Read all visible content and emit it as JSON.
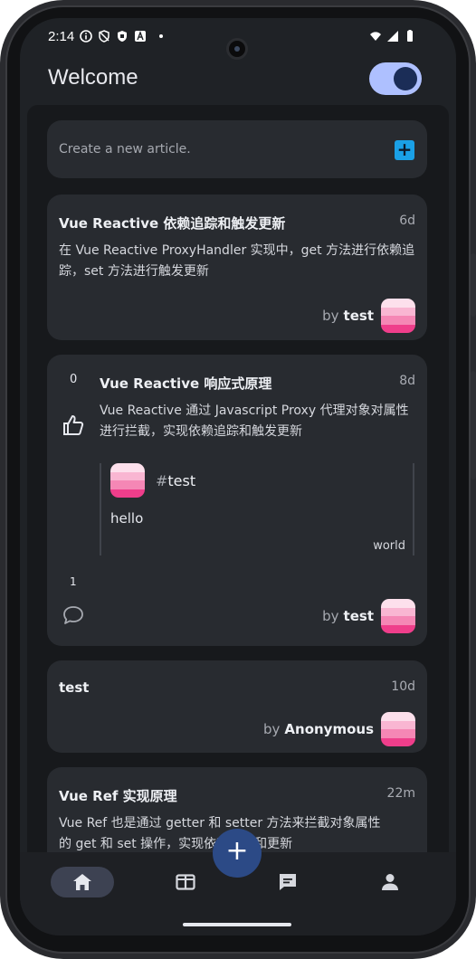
{
  "status_bar": {
    "time": "2:14"
  },
  "app": {
    "title": "Welcome",
    "dark_mode": true
  },
  "composer": {
    "placeholder": "Create a new article."
  },
  "articles": [
    {
      "title": "Vue Reactive 依赖追踪和触发更新",
      "age": "6d",
      "body": "在 Vue Reactive ProxyHandler 实现中，get 方法进行依赖追踪，set 方法进行触发更新",
      "by_label": "by",
      "author": "test"
    },
    {
      "votes": "0",
      "title": "Vue Reactive 响应式原理",
      "age": "8d",
      "body": "Vue Reactive 通过 Javascript Proxy  代理对象对属性进行拦截，实现依赖追踪和触发更新",
      "quote": {
        "hash": "#",
        "tag": "test",
        "text": "hello",
        "link": "world"
      },
      "comments": "1",
      "by_label": "by",
      "author": "test"
    },
    {
      "title": "test",
      "age": "10d",
      "by_label": "by",
      "author": "Anonymous"
    },
    {
      "title": "Vue Ref 实现原理",
      "age": "22m",
      "body_line1": "Vue Ref 也是通过 getter 和 setter 方法来拦截对象属性",
      "body_line2": "的 get 和 set 操作，实现依赖追踪和更新"
    }
  ],
  "fab": {
    "icon": "plus-icon"
  },
  "nav": [
    {
      "icon": "home-icon",
      "active": true
    },
    {
      "icon": "columns-icon",
      "active": false
    },
    {
      "icon": "chat-icon",
      "active": false
    },
    {
      "icon": "person-icon",
      "active": false
    }
  ],
  "colors": {
    "background": "#17191c",
    "card": "#282b30",
    "accent": "#aec0ff",
    "fab": "#2c4a86",
    "add_button": "#1aa0e6",
    "avatar_stripes": [
      "#fde0ec",
      "#f9b6d2",
      "#f587b5",
      "#ef3e8b"
    ]
  }
}
